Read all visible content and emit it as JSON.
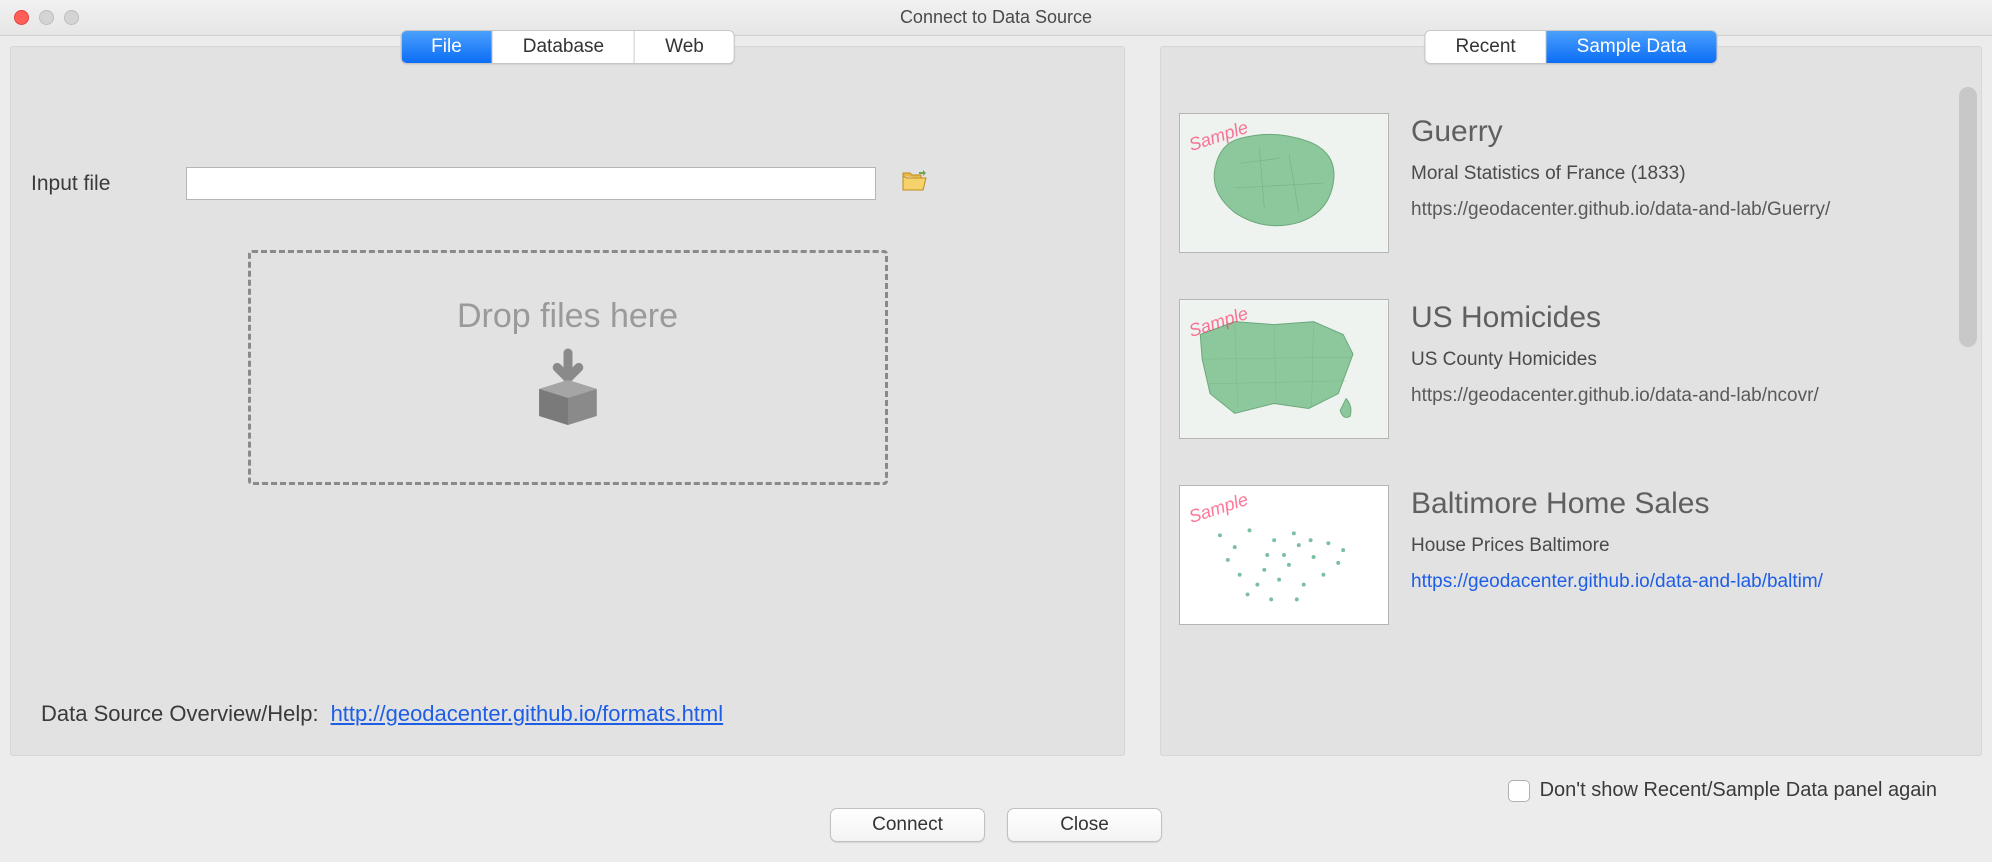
{
  "window": {
    "title": "Connect to Data Source"
  },
  "left_panel": {
    "tabs": [
      "File",
      "Database",
      "Web"
    ],
    "active_tab": "File",
    "input_label": "Input file",
    "input_value": "",
    "dropzone_text": "Drop files here",
    "help_label": "Data Source Overview/Help:",
    "help_url": "http://geodacenter.github.io/formats.html"
  },
  "right_panel": {
    "tabs": [
      "Recent",
      "Sample Data"
    ],
    "active_tab": "Sample Data",
    "watermark": "Sample",
    "items": [
      {
        "title": "Guerry",
        "desc": "Moral Statistics of France (1833)",
        "url": "https://geodacenter.github.io/data-and-lab/Guerry/",
        "url_is_link": false
      },
      {
        "title": "US Homicides",
        "desc": "US County Homicides",
        "url": "https://geodacenter.github.io/data-and-lab/ncovr/",
        "url_is_link": false
      },
      {
        "title": "Baltimore Home Sales",
        "desc": "House Prices Baltimore",
        "url": "https://geodacenter.github.io/data-and-lab/baltim/",
        "url_is_link": true
      }
    ]
  },
  "footer": {
    "dont_show_label": "Don't show Recent/Sample Data panel again",
    "dont_show_checked": false,
    "connect_label": "Connect",
    "close_label": "Close"
  }
}
